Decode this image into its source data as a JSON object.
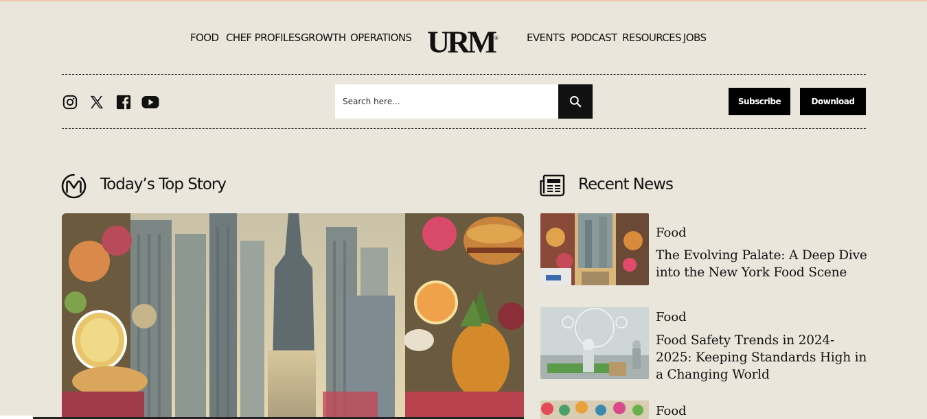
{
  "nav": {
    "left": [
      "FOOD",
      "CHEF PROFILES",
      "GROWTH",
      "OPERATIONS"
    ],
    "logo": "URM",
    "logo_mark": "®",
    "right": [
      "EVENTS",
      "PODCAST",
      "RESOURCES",
      "JOBS"
    ]
  },
  "social": [
    "instagram-icon",
    "x-icon",
    "facebook-icon",
    "youtube-icon"
  ],
  "search": {
    "placeholder": "Search here..."
  },
  "buttons": {
    "subscribe": "Subscribe",
    "download": "Download"
  },
  "top_story": {
    "title": "Today’s Top Story"
  },
  "recent_news": {
    "title": "Recent News",
    "items": [
      {
        "category": "Food",
        "title": "The Evolving Palate: A Deep Dive into the New York Food Scene"
      },
      {
        "category": "Food",
        "title": "Food Safety Trends in 2024-2025: Keeping Standards High in a Changing World"
      },
      {
        "category": "Food",
        "title": ""
      }
    ]
  },
  "colors": {
    "background": "#ebe6dc",
    "accent": "#111111",
    "top_rule": "#efc6a8"
  }
}
